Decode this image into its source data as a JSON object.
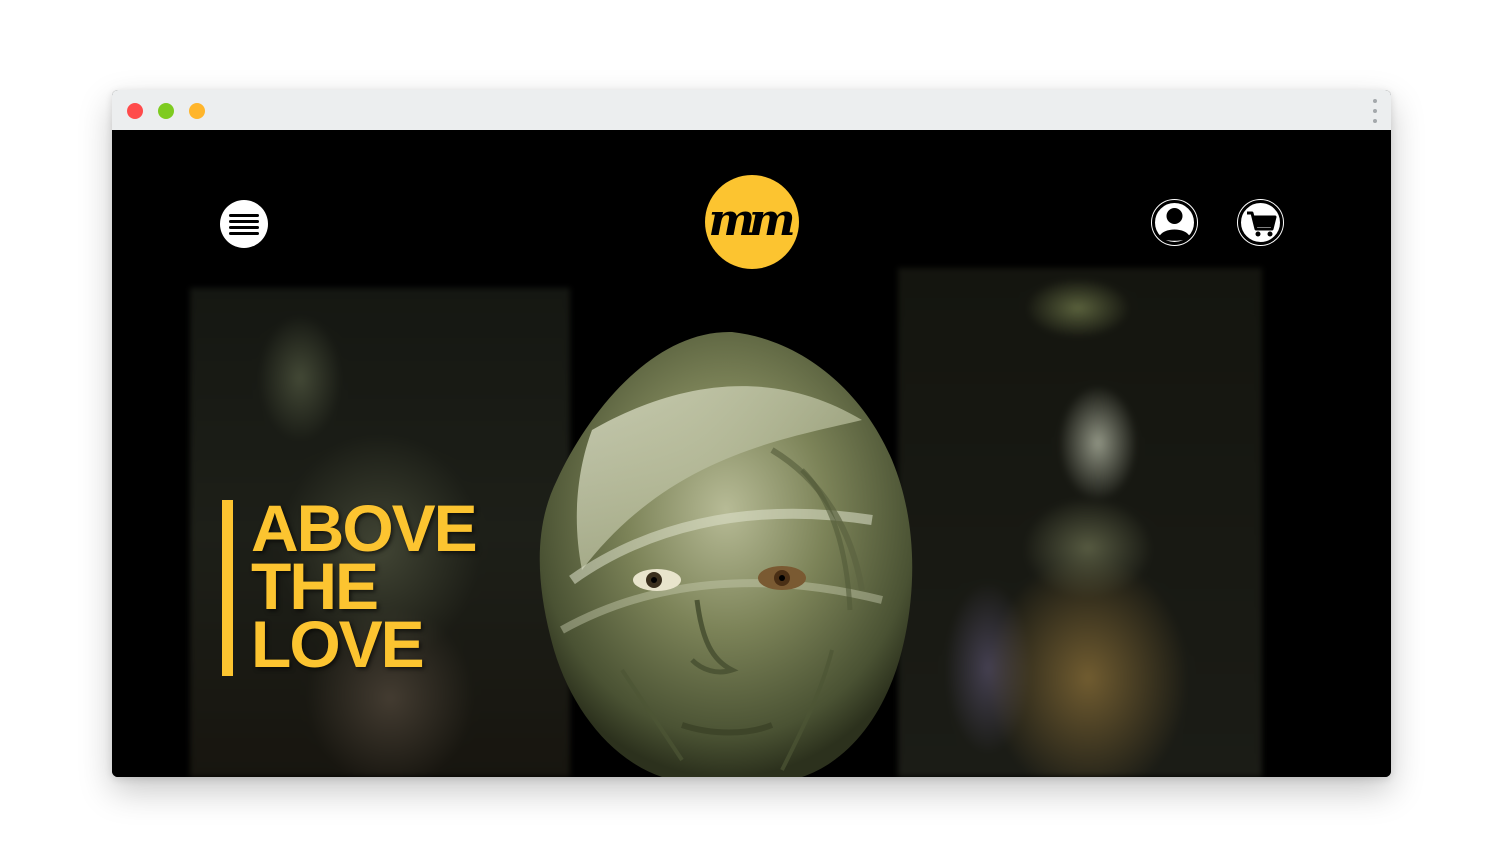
{
  "window": {
    "controls": [
      "close",
      "minimize",
      "maximize"
    ],
    "overflow_menu_icon": "kebab-menu-icon"
  },
  "header": {
    "menu_icon": "hamburger-menu-icon",
    "logo_text": "mm",
    "logo_color": "#fcc430",
    "account_icon": "user-account-icon",
    "cart_icon": "shopping-cart-icon"
  },
  "hero": {
    "headline_lines": [
      "ABOVE",
      "THE",
      "LOVE"
    ],
    "accent_color": "#fcc430",
    "images": [
      "creature-left-image",
      "creature-center-image",
      "creature-right-image"
    ]
  }
}
